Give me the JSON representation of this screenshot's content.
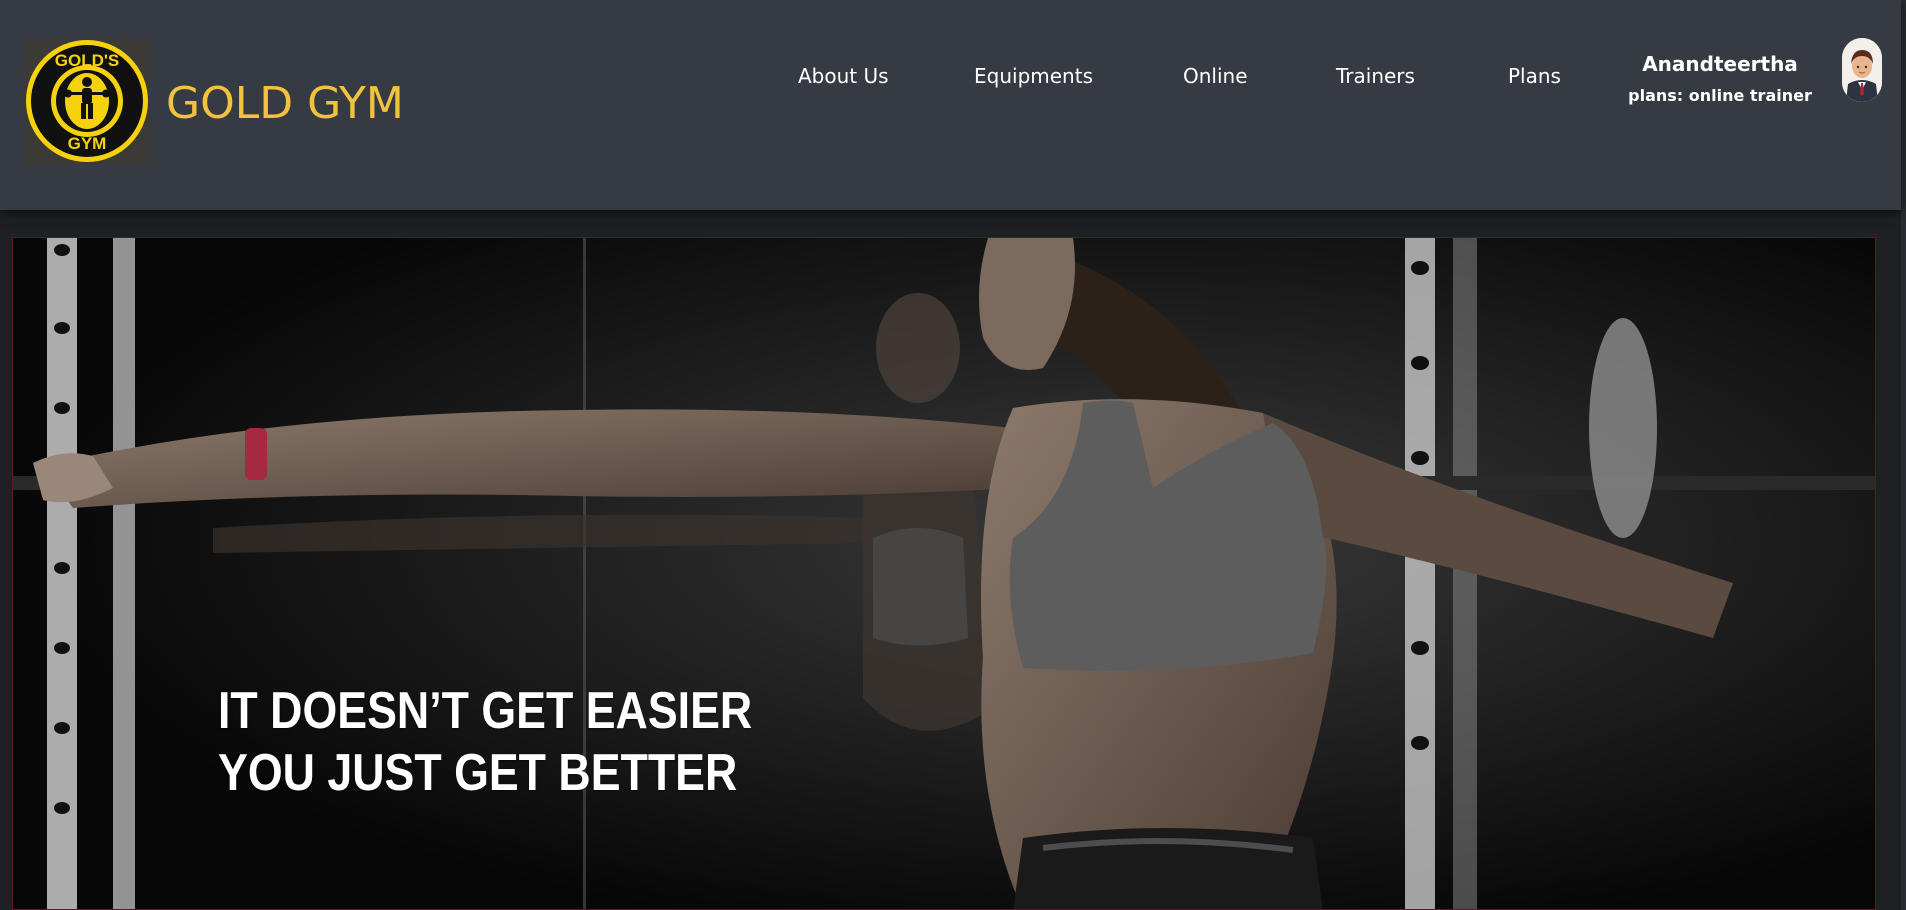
{
  "brand": {
    "logo_text": "GOLD'S GYM",
    "name": "GOLD GYM"
  },
  "nav": {
    "items": [
      "About Us",
      "Equipments",
      "Online",
      "Trainers",
      "Plans"
    ]
  },
  "user": {
    "name": "Anandteertha",
    "plan": "plans: online trainer",
    "avatar_icon": "user-avatar-icon"
  },
  "hero": {
    "tagline_line1": "IT DOESN’T GET EASIER",
    "tagline_line2": "YOU JUST GET BETTER"
  },
  "colors": {
    "header_bg": "#363a42",
    "brand_gold": "#f2c23f",
    "page_bg": "#1f2024"
  }
}
